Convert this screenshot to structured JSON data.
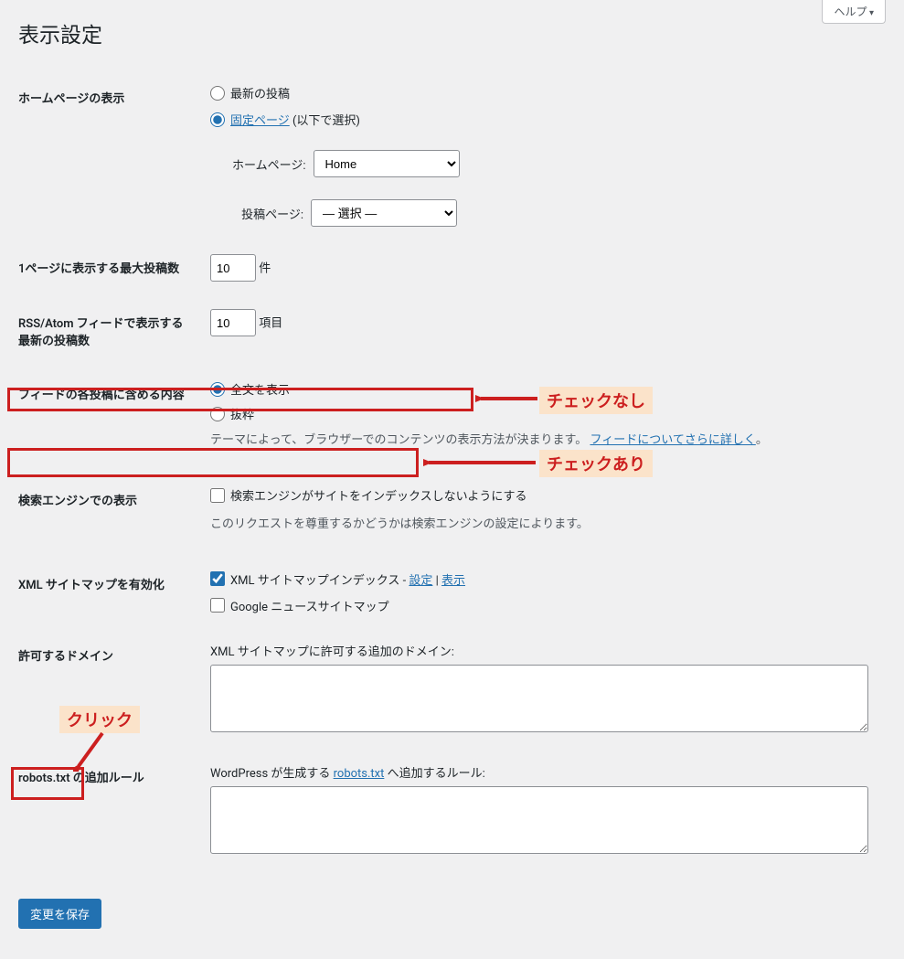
{
  "help_tab": "ヘルプ",
  "page_title": "表示設定",
  "homepage": {
    "label": "ホームページの表示",
    "opt_latest": "最新の投稿",
    "opt_static": "固定ページ",
    "opt_static_note": "(以下で選択)",
    "homepage_label": "ホームページ:",
    "homepage_value": "Home",
    "postspage_label": "投稿ページ:",
    "postspage_value": "— 選択 —"
  },
  "posts_per_page": {
    "label": "1ページに表示する最大投稿数",
    "value": "10",
    "suffix": "件"
  },
  "rss_posts": {
    "label": "RSS/Atom フィードで表示する最新の投稿数",
    "value": "10",
    "suffix": "項目"
  },
  "feed_content": {
    "label": "フィードの各投稿に含める内容",
    "opt_full": "全文を表示",
    "opt_excerpt": "抜粋",
    "desc_pre": "テーマによって、ブラウザーでのコンテンツの表示方法が決まります。",
    "desc_link": "フィードについてさらに詳しく",
    "desc_post": "。"
  },
  "search_engine": {
    "label": "検索エンジンでの表示",
    "checkbox": "検索エンジンがサイトをインデックスしないようにする",
    "desc": "このリクエストを尊重するかどうかは検索エンジンの設定によります。"
  },
  "xml_sitemap": {
    "label": "XML サイトマップを有効化",
    "checkbox": "XML サイトマップインデックス",
    "sep": " - ",
    "link_settings": "設定",
    "link_view": "表示",
    "google_news": "Google ニュースサイトマップ"
  },
  "allowed_domains": {
    "label": "許可するドメイン",
    "desc": "XML サイトマップに許可する追加のドメイン:"
  },
  "robots": {
    "label": "robots.txt の追加ルール",
    "desc_pre": "WordPress が生成する ",
    "desc_link": "robots.txt",
    "desc_post": " へ追加するルール:"
  },
  "save_button": "変更を保存",
  "annotations": {
    "check_off": "チェックなし",
    "check_on": "チェックあり",
    "click": "クリック"
  }
}
